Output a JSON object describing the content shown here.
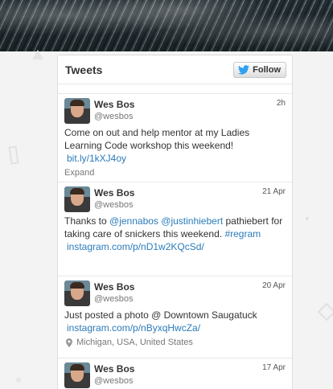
{
  "widget": {
    "title": "Tweets",
    "follow_label": "Follow"
  },
  "tweets": [
    {
      "name": "Wes Bos",
      "handle": "@wesbos",
      "time": "2h",
      "text": "Come on out and help mentor at my Ladies Learning Code workshop this weekend!",
      "url": "bit.ly/1kXJ4oy",
      "footer": "Expand"
    },
    {
      "name": "Wes Bos",
      "handle": "@wesbos",
      "time": "21 Apr",
      "mention1": "@jennabos",
      "mention2": "@justinhiebert",
      "text_before": "Thanks to ",
      "text_after": " pathiebert for taking care of snickers this weekend. ",
      "hashtag": "#regram",
      "url": "instagram.com/p/nD1w2KQcSd/"
    },
    {
      "name": "Wes Bos",
      "handle": "@wesbos",
      "time": "20 Apr",
      "text": "Just posted a photo @ Downtown Saugatuck",
      "url": "instagram.com/p/nByxqHwcZa/",
      "location": "Michigan, USA, United States"
    },
    {
      "name": "Wes Bos",
      "handle": "@wesbos",
      "time": "17 Apr"
    }
  ],
  "colors": {
    "link": "#2b7bb9",
    "background": "#f3f3f3"
  },
  "icons": {
    "follow": "twitter-bird-icon",
    "location": "map-pin-icon"
  }
}
